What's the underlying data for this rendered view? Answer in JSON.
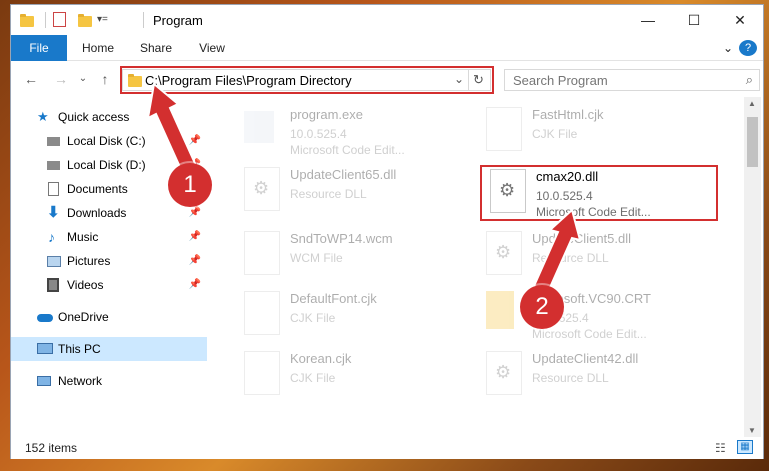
{
  "window": {
    "title": "Program"
  },
  "title_buttons": {
    "minimize": "—",
    "maximize": "☐",
    "close": "✕"
  },
  "ribbon": {
    "tabs": [
      "File",
      "Home",
      "Share",
      "View"
    ],
    "help": "?"
  },
  "nav": {
    "back": "←",
    "forward": "→",
    "recent": "⌄",
    "up": "↑"
  },
  "address": {
    "path": "C:\\Program Files\\Program Directory",
    "dropdown": "⌄",
    "refresh": "↻"
  },
  "search": {
    "placeholder": "Search Program"
  },
  "sidebar": {
    "items": [
      {
        "label": "Quick access",
        "icon": "star-icon",
        "pin": ""
      },
      {
        "label": "Local Disk (C:)",
        "icon": "drive-icon",
        "pin": "📌"
      },
      {
        "label": "Local Disk (D:)",
        "icon": "drive-icon",
        "pin": "📌"
      },
      {
        "label": "Documents",
        "icon": "documents-icon",
        "pin": "📌"
      },
      {
        "label": "Downloads",
        "icon": "download-icon",
        "pin": "📌"
      },
      {
        "label": "Music",
        "icon": "music-icon",
        "pin": "📌"
      },
      {
        "label": "Pictures",
        "icon": "pictures-icon",
        "pin": "📌"
      },
      {
        "label": "Videos",
        "icon": "videos-icon",
        "pin": "📌"
      },
      {
        "label": "OneDrive",
        "icon": "cloud-icon",
        "pin": ""
      },
      {
        "label": "This PC",
        "icon": "computer-icon",
        "pin": ""
      },
      {
        "label": "Network",
        "icon": "network-icon",
        "pin": ""
      }
    ]
  },
  "files": [
    {
      "name": "program.exe",
      "sub1": "10.0.525.4",
      "sub2": "Microsoft Code Edit...",
      "icon": "exe-icon"
    },
    {
      "name": "FastHtml.cjk",
      "sub1": "CJK File",
      "sub2": "",
      "icon": "file-icon"
    },
    {
      "name": "UpdateClient65.dll",
      "sub1": "Resource DLL",
      "sub2": "",
      "icon": "dll-icon"
    },
    {
      "name": "cmax20.dll",
      "sub1": "10.0.525.4",
      "sub2": "Microsoft Code Edit...",
      "icon": "dll-icon"
    },
    {
      "name": "SndToWP14.wcm",
      "sub1": "WCM File",
      "sub2": "",
      "icon": "file-icon"
    },
    {
      "name": "UpdateClient5.dll",
      "sub1": "Resource DLL",
      "sub2": "",
      "icon": "dll-icon"
    },
    {
      "name": "DefaultFont.cjk",
      "sub1": "CJK File",
      "sub2": "",
      "icon": "file-icon"
    },
    {
      "name": "Microsoft.VC90.CRT",
      "sub1": "10.0.525.4",
      "sub2": "Microsoft Code Edit...",
      "icon": "folder-icon"
    },
    {
      "name": "Korean.cjk",
      "sub1": "CJK File",
      "sub2": "",
      "icon": "file-icon"
    },
    {
      "name": "UpdateClient42.dll",
      "sub1": "Resource DLL",
      "sub2": "",
      "icon": "dll-icon"
    }
  ],
  "status": {
    "count": "152 items"
  },
  "annotations": {
    "step1": "1",
    "step2": "2"
  },
  "colors": {
    "accent": "#1979ca",
    "highlight": "#d32f2f",
    "selection": "#cce8ff"
  }
}
